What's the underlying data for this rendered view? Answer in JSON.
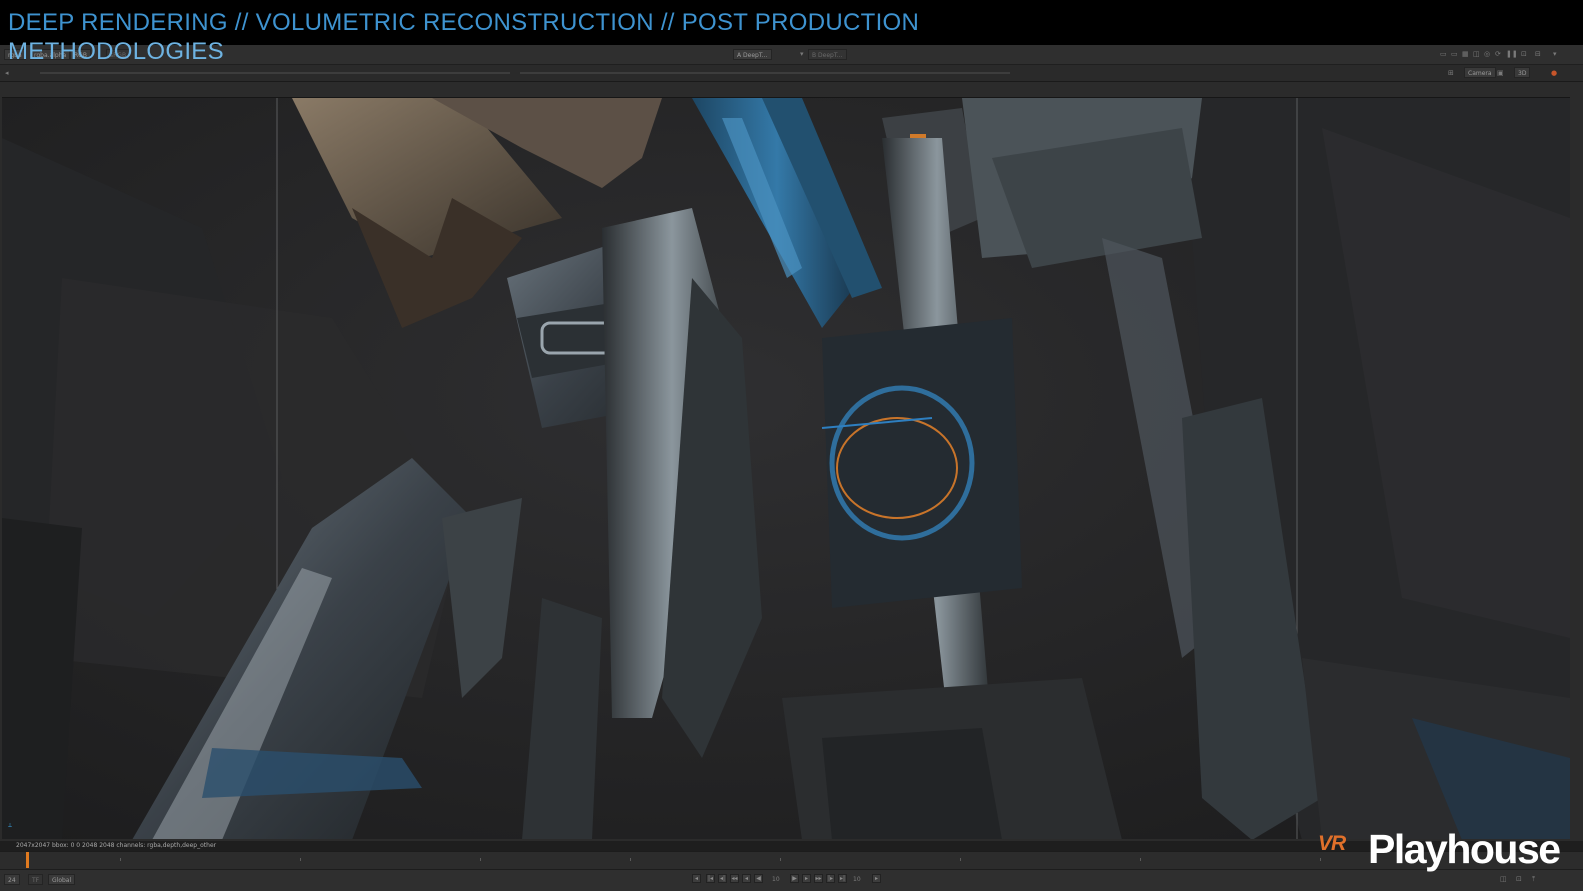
{
  "slide": {
    "title_line1": "DEEP RENDERING // VOLUMETRIC RECONSTRUCTION // POST PRODUCTION",
    "title_line2": "METHODOLOGIES"
  },
  "viewer_toolbar": {
    "channels": "rgba",
    "layer": "rgba.alpha",
    "display": "RGB",
    "lut": "sRGB",
    "input_a": "A DeepT...",
    "input_b": "B DeepT...",
    "camera": "Camera",
    "view_mode": "3D"
  },
  "status": {
    "format_info": "2047x2047  bbox: 0 0 2048 2048 channels: rgba,depth,deep_other"
  },
  "playback": {
    "fps": "24",
    "mode": "Global",
    "frame_field": "10",
    "end_frame": "10"
  },
  "branding": {
    "logo_mark": "VR",
    "name": "Playhouse"
  },
  "colors": {
    "title_blue": "#3e93d0",
    "accent_blue": "#2e7fc0",
    "accent_orange": "#e07a1f"
  }
}
